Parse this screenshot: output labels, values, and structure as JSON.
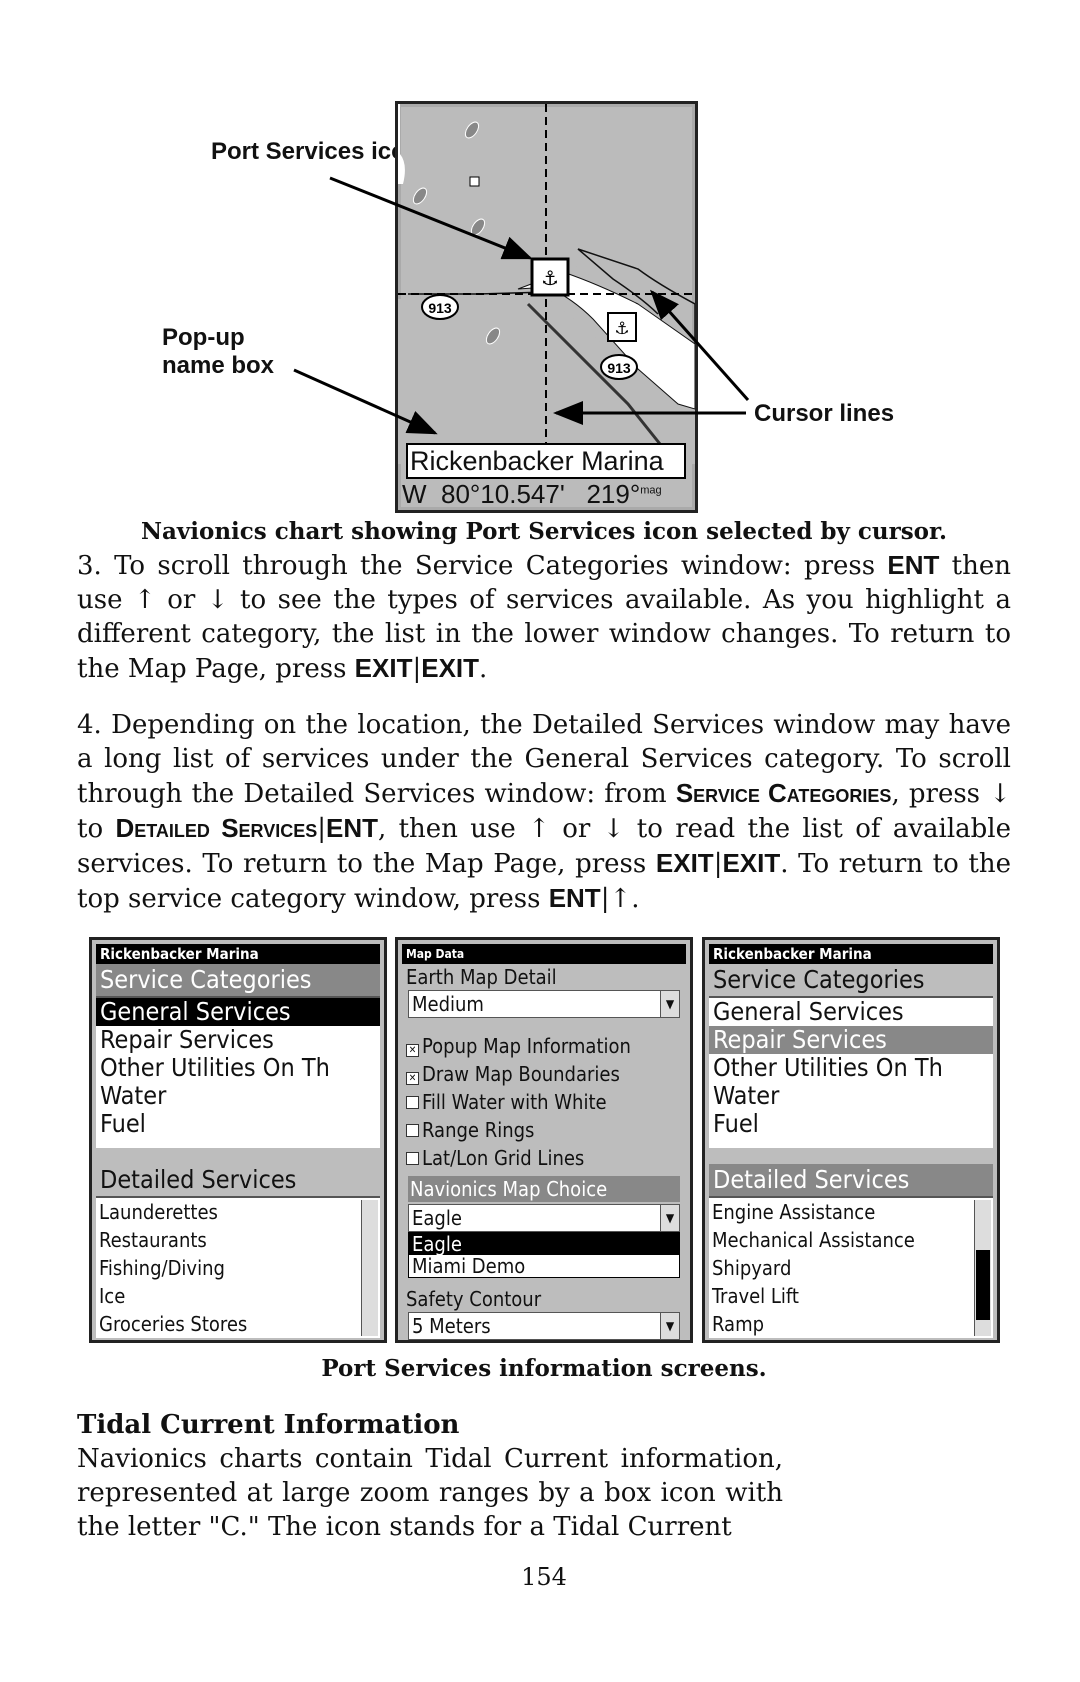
{
  "figure1": {
    "callout_port_services": "Port Services icons",
    "callout_popup": "Pop-up name box",
    "callout_cursor": "Cursor lines",
    "popup_name": "Rickenbacker Marina",
    "coord_readout": "W  80°10.547'   219°",
    "coord_unit": "mag",
    "road_label": "913",
    "caption": "Navionics chart showing Port Services icon selected by cursor."
  },
  "para3": {
    "a": "3. To scroll through the Service Categories window: press ",
    "k1": "ENT",
    "b": " then use ↑ or ↓ to see the types of services available. As you highlight a different category, the list in the lower window changes. To return to the Map Page, press ",
    "k2": "EXIT",
    "sep": "|",
    "k3": "EXIT",
    "c": "."
  },
  "para4": {
    "a": "4. Depending on the location, the Detailed Services window may have a long list of services under the General Services category. To scroll through the Detailed Services window: from ",
    "sc1": "Service Categories",
    "b": ", press ↓ to ",
    "sc2": "Detailed Services",
    "sep": "|",
    "k1": "ENT",
    "c": ", then use ↑ or ↓ to read the list of available services. To return to the Map Page, press ",
    "k2": "EXIT",
    "k3": "EXIT",
    "d": ". To return to the top service category window, press ",
    "k4": "ENT",
    "e": "↑."
  },
  "screen1": {
    "title": "Rickenbacker Marina",
    "categories_header": "Service Categories",
    "categories": [
      "General Services",
      "Repair Services",
      "Other Utilities On Th",
      "Water",
      "Fuel"
    ],
    "details_header": "Detailed Services",
    "details": [
      "Launderettes",
      "Restaurants",
      "Fishing/Diving",
      "Ice",
      "Groceries Stores"
    ]
  },
  "screen2": {
    "title": "Map Data",
    "earth_label": "Earth Map Detail",
    "earth_value": "Medium",
    "options": [
      {
        "label": "Popup Map Information",
        "checked": true
      },
      {
        "label": "Draw Map Boundaries",
        "checked": true
      },
      {
        "label": "Fill Water with White",
        "checked": false
      },
      {
        "label": "Range Rings",
        "checked": false
      },
      {
        "label": "Lat/Lon Grid Lines",
        "checked": false
      }
    ],
    "choice_header": "Navionics Map Choice",
    "choice_value": "Eagle",
    "choice_options": [
      "Eagle",
      "Miami Demo"
    ],
    "safety_label": "Safety Contour",
    "safety_value": "5 Meters"
  },
  "screen3": {
    "title": "Rickenbacker Marina",
    "categories_header": "Service Categories",
    "categories": [
      "General Services",
      "Repair Services",
      "Other Utilities On Th",
      "Water",
      "Fuel"
    ],
    "details_header": "Detailed Services",
    "details": [
      "Engine Assistance",
      "Mechanical Assistance",
      "Shipyard",
      "Travel Lift",
      "Ramp"
    ]
  },
  "caption2": "Port Services information screens.",
  "section": {
    "heading": "Tidal Current Information",
    "body": "Navionics charts contain Tidal Current information, represented at large zoom ranges by a box icon with the letter \"C.\" The icon stands for a Tidal Current"
  },
  "page_number": "154"
}
